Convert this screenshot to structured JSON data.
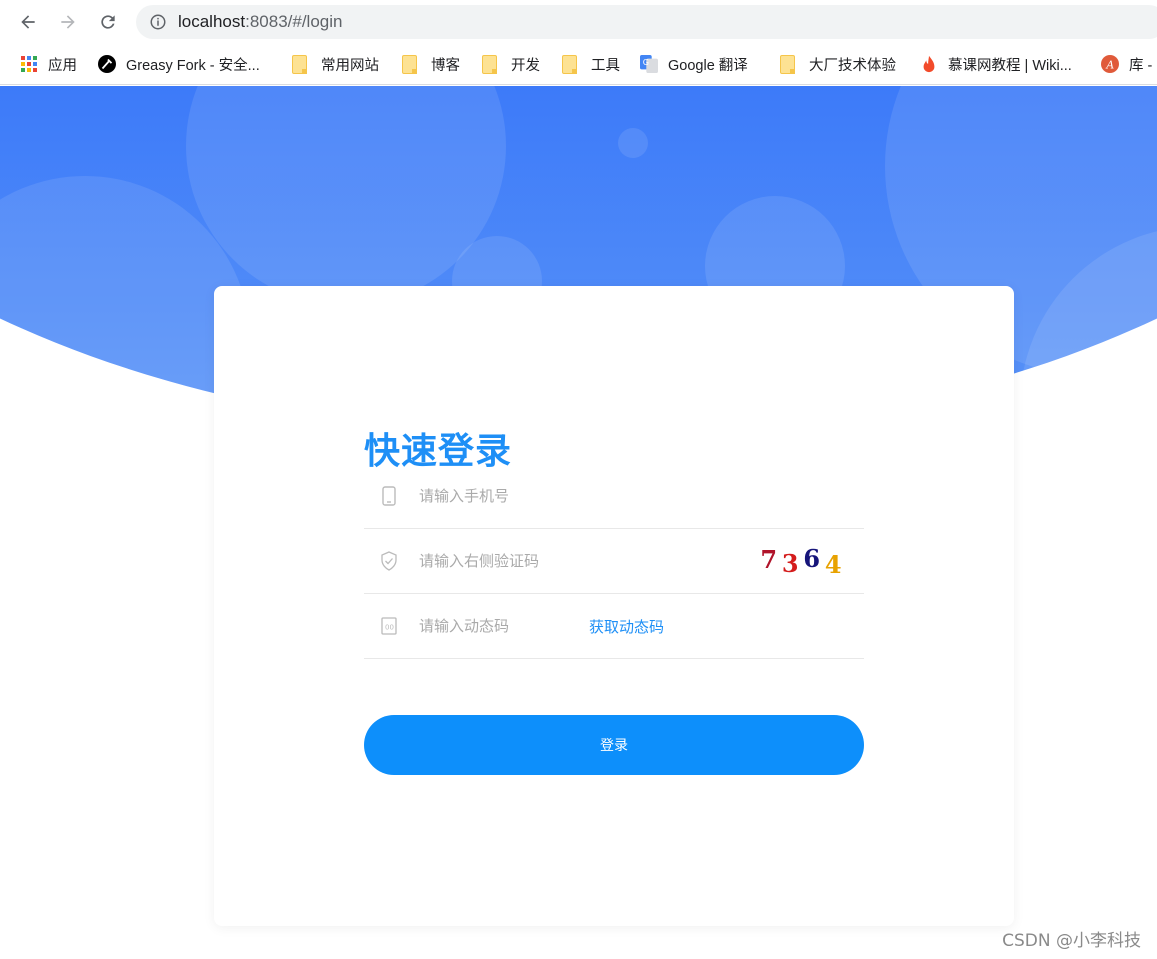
{
  "browser": {
    "url_host": "localhost",
    "url_path": ":8083/#/login"
  },
  "bookmarks": [
    {
      "label": "应用",
      "icon": "apps-grid-icon"
    },
    {
      "label": "Greasy Fork - 安全...",
      "icon": "greasyfork-icon"
    },
    {
      "label": "常用网站",
      "icon": "folder-icon"
    },
    {
      "label": "博客",
      "icon": "folder-icon"
    },
    {
      "label": "开发",
      "icon": "folder-icon"
    },
    {
      "label": "工具",
      "icon": "folder-icon"
    },
    {
      "label": "Google 翻译",
      "icon": "google-translate-icon"
    },
    {
      "label": "大厂技术体验",
      "icon": "folder-icon"
    },
    {
      "label": "慕课网教程 | Wiki...",
      "icon": "imooc-flame-icon"
    },
    {
      "label": "库 -",
      "icon": "library-icon"
    }
  ],
  "login": {
    "title": "快速登录",
    "phone_placeholder": "请输入手机号",
    "captcha_placeholder": "请输入右侧验证码",
    "captcha_chars": [
      "7",
      "3",
      "6",
      "4"
    ],
    "captcha_colors": [
      "#b0132a",
      "#d41c1c",
      "#16157a",
      "#e8a200"
    ],
    "code_placeholder": "请输入动态码",
    "get_code_label": "获取动态码",
    "submit_label": "登录"
  },
  "colors": {
    "accent": "#1e8ff6",
    "button": "#0d8ffb",
    "hero": "#2c63fb"
  },
  "watermark": "CSDN @小李科技"
}
